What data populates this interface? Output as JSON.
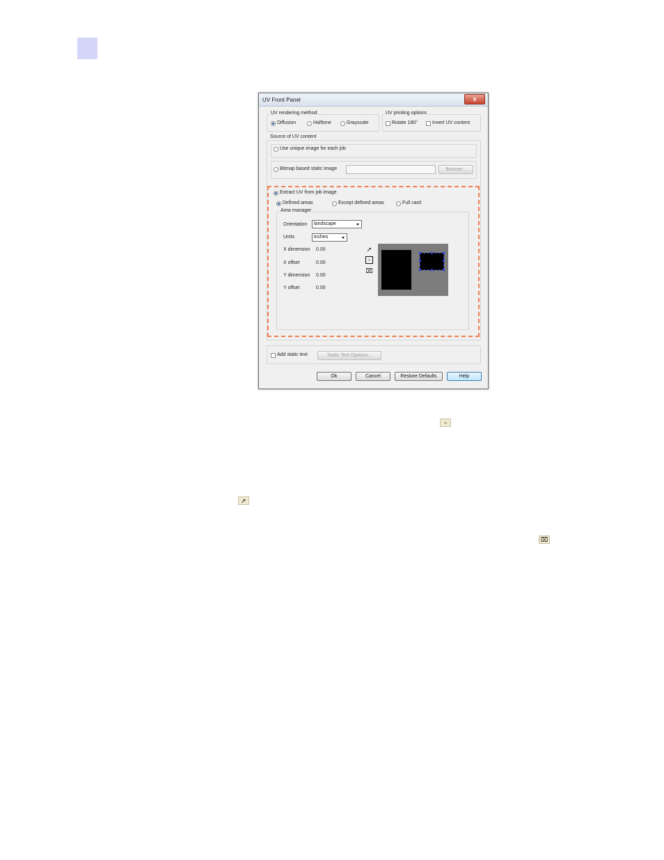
{
  "dialog": {
    "title": "UV Front Panel",
    "close_glyph": "x",
    "rendering": {
      "legend": "UV rendering method",
      "options": [
        "Diffusion",
        "Halftone",
        "Grayscale"
      ]
    },
    "printing": {
      "legend": "UV printing options",
      "rotate": "Rotate 180°",
      "invert": "Invert UV content"
    },
    "source": {
      "legend": "Source of UV content",
      "unique": "Use unique image for each job",
      "bitmap": "Bitmap based static image",
      "browse": "Browse...",
      "extract": "Extract UV from job image",
      "defined": "Defined areas",
      "except": "Except defined areas",
      "full": "Full card"
    },
    "area": {
      "legend": "Area manager",
      "orientation_label": "Orientation",
      "orientation_value": "landscape",
      "units_label": "Units",
      "units_value": "inches",
      "x_dim_label": "X dimension",
      "x_dim_value": "0.00",
      "x_off_label": "X offset",
      "x_off_value": "0.00",
      "y_dim_label": "Y dimension",
      "y_dim_value": "0.00",
      "y_off_label": "Y offset",
      "y_off_value": "0.00"
    },
    "static_text": {
      "label": "Add static text",
      "options_button": "Static Text Options..."
    },
    "buttons": {
      "ok": "Ok",
      "cancel": "Cancel",
      "restore": "Restore Defaults",
      "help": "Help"
    }
  },
  "icons": {
    "select_arrow": "arrow-pointer-icon",
    "rectangle": "rectangle-tool-icon",
    "delete": "delete-area-icon"
  },
  "colors": {
    "highlight": "#f07c51",
    "page_tab": "#d6d6fb"
  }
}
